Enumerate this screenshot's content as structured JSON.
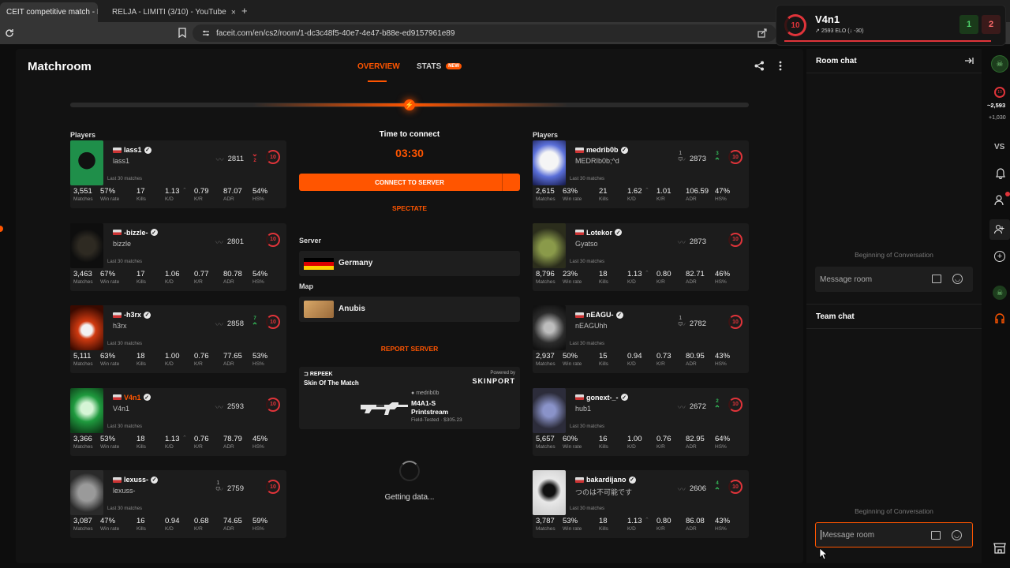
{
  "browser": {
    "tabs": [
      {
        "title": "CEIT competitive match - F",
        "close": "×"
      },
      {
        "title": "RELJA - LIMITI (3/10) - YouTube",
        "close": "×"
      }
    ],
    "new_tab": "+",
    "url": "faceit.com/en/cs2/room/1-dc3c48f5-40e7-4e47-b88e-ed9157961e89"
  },
  "header": {
    "title": "Matchroom",
    "tabs": [
      {
        "label": "OVERVIEW",
        "active": true
      },
      {
        "label": "STATS",
        "badge": "NEW"
      }
    ]
  },
  "teams": {
    "left_label": "Players",
    "right_label": "Players",
    "last30_label": "Last 30 matches",
    "stat_labels": [
      "Matches",
      "Win rate",
      "Kills",
      "K/D",
      "K/R",
      "ADR",
      "HS%"
    ],
    "left": [
      {
        "nick": "lass1",
        "real": "lass1",
        "elo": "2811",
        "delta": "2",
        "dir": "down",
        "level": "10",
        "stats": [
          "3,551",
          "57%",
          "17",
          "1.13",
          "0.79",
          "87.07",
          "54%"
        ],
        "kd_up": true,
        "avatar": "green-mask"
      },
      {
        "nick": "-bizzle-",
        "real": "bizzle",
        "elo": "2801",
        "level": "10",
        "stats": [
          "3,463",
          "67%",
          "17",
          "1.06",
          "0.77",
          "80.78",
          "54%"
        ],
        "avatar": "dark-pin"
      },
      {
        "nick": "-h3rx",
        "real": "h3rx",
        "elo": "2858",
        "delta": "7",
        "dir": "up",
        "level": "10",
        "stats": [
          "5,111",
          "63%",
          "18",
          "1.00",
          "0.76",
          "77.65",
          "53%"
        ],
        "avatar": "fire"
      },
      {
        "nick": "V4n1",
        "real": "V4n1",
        "elo": "2593",
        "level": "10",
        "highlight": true,
        "stats": [
          "3,366",
          "53%",
          "18",
          "1.13",
          "0.76",
          "78.79",
          "45%"
        ],
        "kd_up": true,
        "avatar": "green-skull"
      },
      {
        "nick": "lexuss-",
        "real": "lexuss-",
        "elo": "2759",
        "party": "1",
        "level": "10",
        "stats": [
          "3,087",
          "47%",
          "16",
          "0.94",
          "0.68",
          "74.65",
          "59%"
        ],
        "avatar": "grey"
      }
    ],
    "right": [
      {
        "nick": "medrib0b",
        "real": "MEDRIb0b;^d",
        "elo": "2873",
        "delta": "3",
        "dir": "up",
        "party": "1",
        "level": "10",
        "stats": [
          "2,615",
          "63%",
          "21",
          "1.62",
          "1.01",
          "106.59",
          "47%"
        ],
        "kd_up": true,
        "avatar": "blue-white"
      },
      {
        "nick": "Lotekor",
        "real": "Gyatso",
        "elo": "2873",
        "level": "10",
        "stats": [
          "8,796",
          "23%",
          "18",
          "1.13",
          "0.80",
          "82.71",
          "46%"
        ],
        "kd_up": true,
        "avatar": "olive"
      },
      {
        "nick": "nEAGU-",
        "real": "nEAGUhh",
        "elo": "2782",
        "party": "1",
        "level": "10",
        "stats": [
          "2,937",
          "50%",
          "15",
          "0.94",
          "0.73",
          "80.95",
          "43%"
        ],
        "avatar": "mono"
      },
      {
        "nick": "gonext-_-",
        "real": "hub1",
        "elo": "2672",
        "delta": "2",
        "dir": "up",
        "level": "10",
        "stats": [
          "5,657",
          "60%",
          "16",
          "1.00",
          "0.76",
          "82.95",
          "64%"
        ],
        "avatar": "purple"
      },
      {
        "nick": "bakardijano",
        "real": "つのは不可能です",
        "elo": "2606",
        "delta": "4",
        "dir": "up",
        "level": "10",
        "stats": [
          "3,787",
          "53%",
          "18",
          "1.13",
          "0.80",
          "86.08",
          "43%"
        ],
        "kd_up": true,
        "avatar": "sketch"
      }
    ]
  },
  "center": {
    "time_label": "Time to connect",
    "timer": "03:30",
    "connect_btn": "CONNECT TO SERVER",
    "spectate": "SPECTATE",
    "server_label": "Server",
    "server_value": "Germany",
    "map_label": "Map",
    "map_value": "Anubis",
    "report": "REPORT SERVER",
    "skin": {
      "brand": "REPEEK",
      "title": "Skin Of The Match",
      "powered": "Powered by",
      "partner": "SKINPORT",
      "owner": "medrib0b",
      "weapon": "M4A1-S",
      "skin_name": "Printstream",
      "condition": "Field-Tested · $305.23"
    },
    "loading": "Getting data..."
  },
  "chat": {
    "room_title": "Room chat",
    "team_title": "Team chat",
    "begin": "Beginning of Conversation",
    "placeholder": "Message room"
  },
  "popup": {
    "name": "V4n1",
    "elo": "2593 ELO",
    "change": "-30",
    "level": "10",
    "wins": "1",
    "losses": "2"
  },
  "rail": {
    "elo": "~2,593",
    "gain": "+1,030",
    "vs": "VS"
  },
  "colors": {
    "accent": "#ff5500",
    "red": "#e0343a",
    "green": "#35c25c"
  }
}
